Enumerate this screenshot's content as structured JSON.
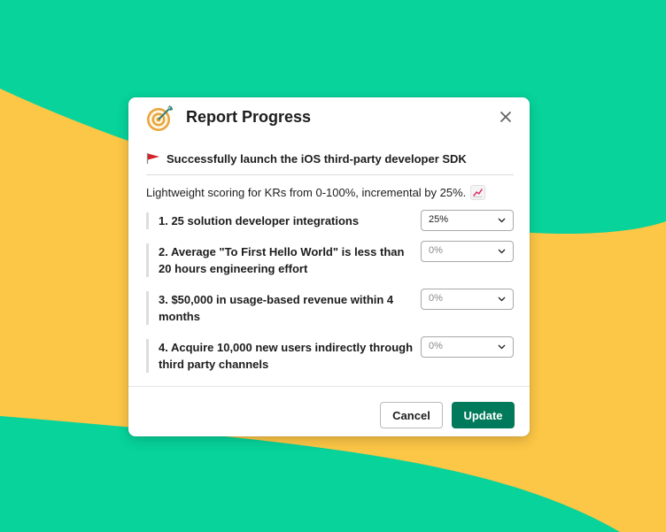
{
  "colors": {
    "background": "#07d39b",
    "wave": "#fcc646",
    "primary_button": "#007a5a",
    "flag": "#d2232a"
  },
  "modal": {
    "title": "Report Progress",
    "icon": "target-icon",
    "close_icon": "close-icon",
    "objective": {
      "icon": "red-flag-icon",
      "text": "Successfully launch the iOS third-party developer SDK"
    },
    "intro_text": "Lightweight scoring for KRs from 0-100%, incremental by 25%.",
    "intro_icon": "chart-increasing-icon",
    "key_results": [
      {
        "text": "1. 25 solution developer integrations",
        "value": "25%",
        "is_placeholder": false
      },
      {
        "text": "2. Average \"To First Hello World\" is less than 20 hours engineering effort",
        "value": "0%",
        "is_placeholder": true
      },
      {
        "text": "3. $50,000 in usage-based revenue within 4 months",
        "value": "0%",
        "is_placeholder": true
      },
      {
        "text": "4. Acquire 10,000 new users indirectly through third party channels",
        "value": "0%",
        "is_placeholder": true
      }
    ],
    "buttons": {
      "cancel": "Cancel",
      "update": "Update"
    }
  }
}
